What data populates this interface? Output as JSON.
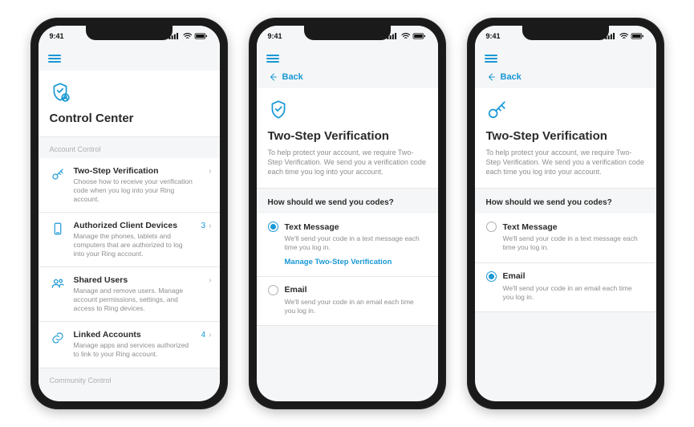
{
  "status": {
    "time": "9:41"
  },
  "nav": {
    "back_label": "Back"
  },
  "screen1": {
    "hero_title": "Control Center",
    "section_account": "Account Control",
    "section_community": "Community Control",
    "items": [
      {
        "title": "Two-Step Verification",
        "desc": "Choose how to receive your verification code when you log into your Ring account.",
        "badge": ""
      },
      {
        "title": "Authorized Client Devices",
        "desc": "Manage the phones, tablets and computers that are authorized to log into your Ring account.",
        "badge": "3"
      },
      {
        "title": "Shared Users",
        "desc": "Manage and remove users. Manage account permissions, settings, and access to Ring devices.",
        "badge": ""
      },
      {
        "title": "Linked Accounts",
        "desc": "Manage apps and services authorized to link to your Ring account.",
        "badge": "4"
      }
    ]
  },
  "tsv": {
    "hero_title": "Two-Step Verification",
    "hero_sub": "To help protect your account, we require Two-Step Verification. We send you a verification code each time you log into your account.",
    "question": "How should we send you codes?",
    "options": {
      "text": {
        "title": "Text Message",
        "desc": "We'll send your code in a text message each time you log in."
      },
      "email": {
        "title": "Email",
        "desc": "We'll send your code in an email each time you log in."
      }
    },
    "manage_link": "Manage Two-Step Verification"
  }
}
